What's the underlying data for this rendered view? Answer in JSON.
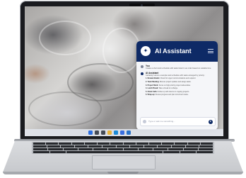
{
  "taskbar": {
    "time": "",
    "icons": [
      "start-icon",
      "search-icon",
      "task-view-icon",
      "explorer-icon",
      "edge-icon",
      "store-icon",
      "mail-icon"
    ],
    "icon_colors": [
      "#2b6de0",
      "#444a55",
      "#444a55",
      "#e8b23b",
      "#1c8ad6",
      "#3a6ee0",
      "#2a72c9"
    ]
  },
  "assistant": {
    "title": "AI Assistant",
    "accent_color": "#0e2a66",
    "user_message": {
      "who": "You",
      "text": "Create a short work schedule with tasks listed in an order based on suitable time"
    },
    "assistant_message": {
      "who": "AI Assistant",
      "intro": "Certainly! Here's a sample work schedule with tasks arranged by priority:",
      "steps": [
        {
          "num": "1.",
          "title": "Review Emails:",
          "text": "Check for urgent communications and respond."
        },
        {
          "num": "2.",
          "title": "Team Meeting:",
          "text": "Discuss project updates and assign tasks."
        },
        {
          "num": "3.",
          "title": "Project Work:",
          "text": "Focus on high-priority project deliverables."
        },
        {
          "num": "4.",
          "title": "Lunch Break:",
          "text": "Take a break to recharge."
        },
        {
          "num": "5.",
          "title": "Client Calls:",
          "text": "Follow up with clients on ongoing projects."
        },
        {
          "num": "6.",
          "title": "Wrap-up:",
          "text": "Review progress and plan tomorrow's tasks."
        }
      ]
    },
    "input": {
      "placeholder": "Type or ask me something..."
    }
  }
}
